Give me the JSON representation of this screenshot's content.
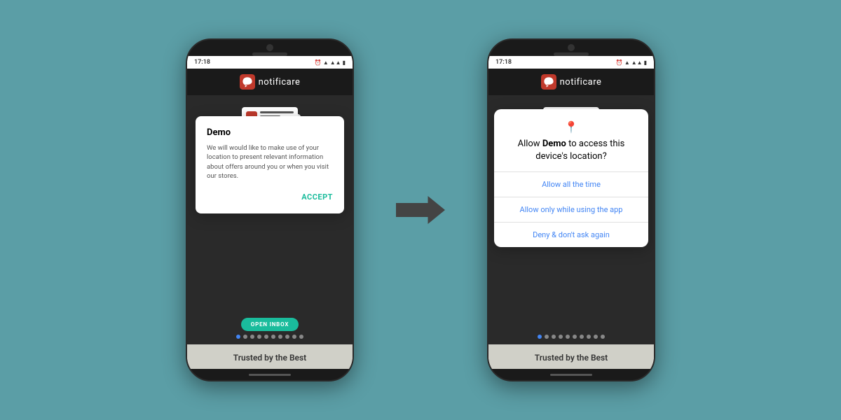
{
  "background_color": "#5b9ea6",
  "phone1": {
    "status_time": "17:18",
    "app_name": "notificare",
    "dialog": {
      "title": "Demo",
      "body": "We will would like to make use of your location to present relevant information about offers around you or when you visit our stores.",
      "accept_label": "ACCEPT"
    },
    "open_inbox_label": "OPEN INBOX",
    "dots_count": 10,
    "active_dot": 0,
    "trusted_label": "Trusted by the Best"
  },
  "phone2": {
    "status_time": "17:18",
    "app_name": "notificare",
    "location_dialog": {
      "title_part1": "Allow ",
      "title_bold": "Demo",
      "title_part2": " to access this device's location?",
      "option1": "Allow all the time",
      "option2": "Allow only while using the app",
      "option3": "Deny & don't ask again"
    },
    "dots_count": 10,
    "active_dot": 0,
    "trusted_label": "Trusted by the Best"
  },
  "arrow": "→"
}
